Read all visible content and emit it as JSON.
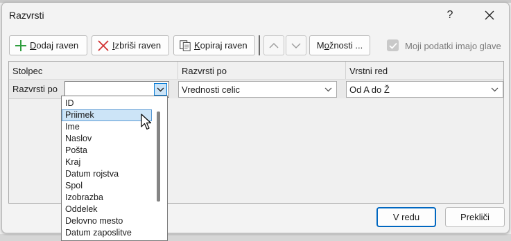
{
  "dialog": {
    "title": "Razvrsti",
    "help_label": "?",
    "close_label": "close"
  },
  "toolbar": {
    "add_level": {
      "key": "D",
      "rest": "odaj raven",
      "icon": "plus-icon"
    },
    "delete_level": {
      "key": "I",
      "rest": "zbriši raven",
      "icon": "delete-x-icon"
    },
    "copy_level": {
      "key": "K",
      "rest": "opiraj raven",
      "icon": "copy-icon"
    },
    "move_up_icon": "chevron-up-icon",
    "move_down_icon": "chevron-down-icon",
    "options": {
      "pre": "M",
      "key": "o",
      "rest": "žnosti ..."
    },
    "header_checkbox_label": "Moji podatki imajo glave",
    "header_checkbox_checked": true
  },
  "grid": {
    "columns": [
      "Stolpec",
      "Razvrsti po",
      "Vrstni red"
    ],
    "row_label": "Razvrsti po",
    "column_value": "",
    "sort_on_value": "Vrednosti celic",
    "order_value": "Od A do Ž"
  },
  "dropdown": {
    "open": true,
    "selected_index": 1,
    "options": [
      "ID",
      "Priimek",
      "Ime",
      "Naslov",
      "Pošta",
      "Kraj",
      "Datum rojstva",
      "Spol",
      "Izobrazba",
      "Oddelek",
      "Delovno mesto",
      "Datum zaposlitve"
    ]
  },
  "buttons": {
    "ok": "V redu",
    "cancel": "Prekliči"
  },
  "colors": {
    "accent": "#0067c0",
    "selection": "#cce4f7",
    "add_green": "#2e9e3e",
    "delete_red": "#d12f2f"
  }
}
